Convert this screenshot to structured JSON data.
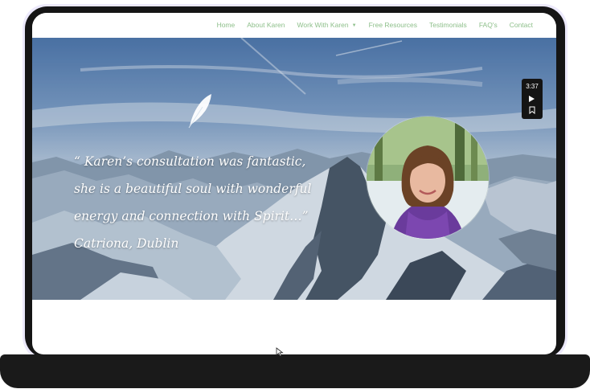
{
  "nav": {
    "items": [
      "Home",
      "About Karen",
      "Work With Karen",
      "Free Resources",
      "Testimonials",
      "FAQ's",
      "Contact"
    ]
  },
  "hero": {
    "quote": "“ Karen’s consultation was fantastic, she is a beautiful soul with wonderful energy and connection with Spirit…” Catriona, Dublin"
  },
  "video": {
    "duration": "3:37"
  },
  "colors": {
    "nav_link": "#8dbf8a",
    "laptop_frame": "#151515",
    "quote_text": "#ffffff"
  },
  "icons": [
    "feather-icon",
    "play-icon",
    "bookmark-icon",
    "chevron-down-icon",
    "cursor-icon"
  ]
}
